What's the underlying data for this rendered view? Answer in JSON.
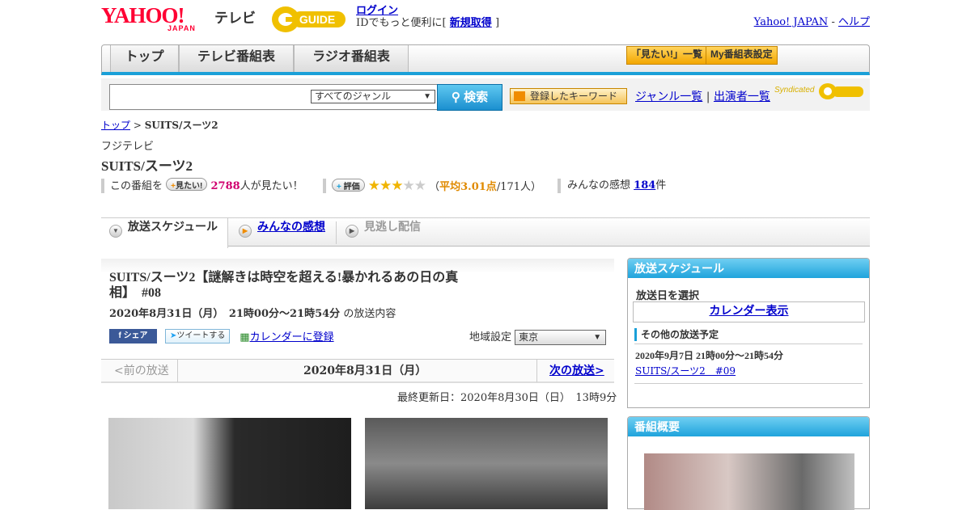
{
  "header": {
    "logo_text": "YAHOO!",
    "logo_sub": "JAPAN",
    "tv_label": "テレビ",
    "gguide_text": "GUIDE",
    "login_label": "ログイン",
    "id_text": "IDでもっと便利に[",
    "register_label": "新規取得",
    "id_text_end": "]",
    "yahoo_link": "Yahoo! JAPAN",
    "link_sep": "-",
    "help_link": "ヘルプ"
  },
  "nav": {
    "tabs": [
      "トップ",
      "テレビ番組表",
      "ラジオ番組表"
    ],
    "mitai_list": "「見たい!」一覧",
    "my_bangumi": "My番組表設定"
  },
  "search": {
    "genre_selected": "すべてのジャンル",
    "button_label": "検索",
    "keyword_button": "登録したキーワード",
    "genre_link": "ジャンル一覧",
    "link_sep": "|",
    "cast_link": "出演者一覧",
    "syndicated": "Syndicated"
  },
  "breadcrumb": {
    "top": "トップ",
    "sep": ">",
    "current": "SUITS/スーツ2"
  },
  "program": {
    "channel": "フジテレビ",
    "title": "SUITS/スーツ2",
    "mitai_prefix": "この番組を",
    "mitai_btn": "見たい!",
    "mitai_count": "2788",
    "mitai_suffix": "人が見たい！",
    "rate_btn": "評価",
    "rating_stars": 3,
    "rating_open": "（",
    "rating_avg": "平均3.01点",
    "rating_count": "/171人）",
    "kanso_label": "みんなの感想",
    "kanso_count": "184",
    "kanso_suffix": "件"
  },
  "section_tabs": {
    "schedule": "放送スケジュール",
    "impressions": "みんなの感想",
    "streaming": "見逃し配信"
  },
  "episode": {
    "title_line1": "SUITS/スーツ2【謎解きは時空を超える!暴かれるあの日の真",
    "title_line2": "相】　#08",
    "date": "2020年8月31日（月）　21時00分～21時54分",
    "date_suffix": "の放送内容",
    "share": "シェア",
    "tweet": "ツイートする",
    "calendar": "カレンダーに登録",
    "region_label": "地域設定",
    "region_value": "東京"
  },
  "pager": {
    "prev": "<前の放送",
    "current": "2020年8月31日（月）",
    "next": "次の放送>"
  },
  "updated": "最終更新日：2020年8月30日（日）　13時9分",
  "sidebar": {
    "schedule_title": "放送スケジュール",
    "pick_date": "放送日を選択",
    "calendar_link": "カレンダー表示",
    "other_title": "その他の放送予定",
    "other_date": "2020年9月7日  21時00分～21時54分",
    "other_link": "SUITS/スーツ2　#09",
    "summary_title": "番組概要"
  }
}
